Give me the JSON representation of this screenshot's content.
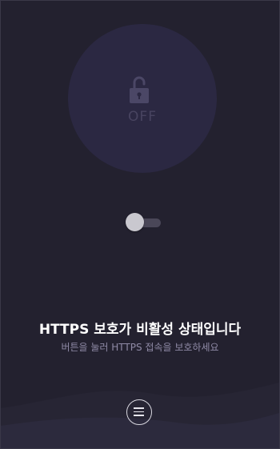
{
  "status": {
    "lock_icon": "lock-icon",
    "label": "OFF"
  },
  "toggle": {
    "state": "off"
  },
  "message": {
    "headline": "HTTPS 보호가 비활성 상태입니다",
    "subline": "버튼을 눌러 HTTPS 접속을 보호하세요"
  },
  "menu": {
    "icon": "menu-icon"
  },
  "colors": {
    "background": "#23212f",
    "circle": "#2b2842",
    "muted": "#484460",
    "subtext": "#8f8aa6"
  }
}
